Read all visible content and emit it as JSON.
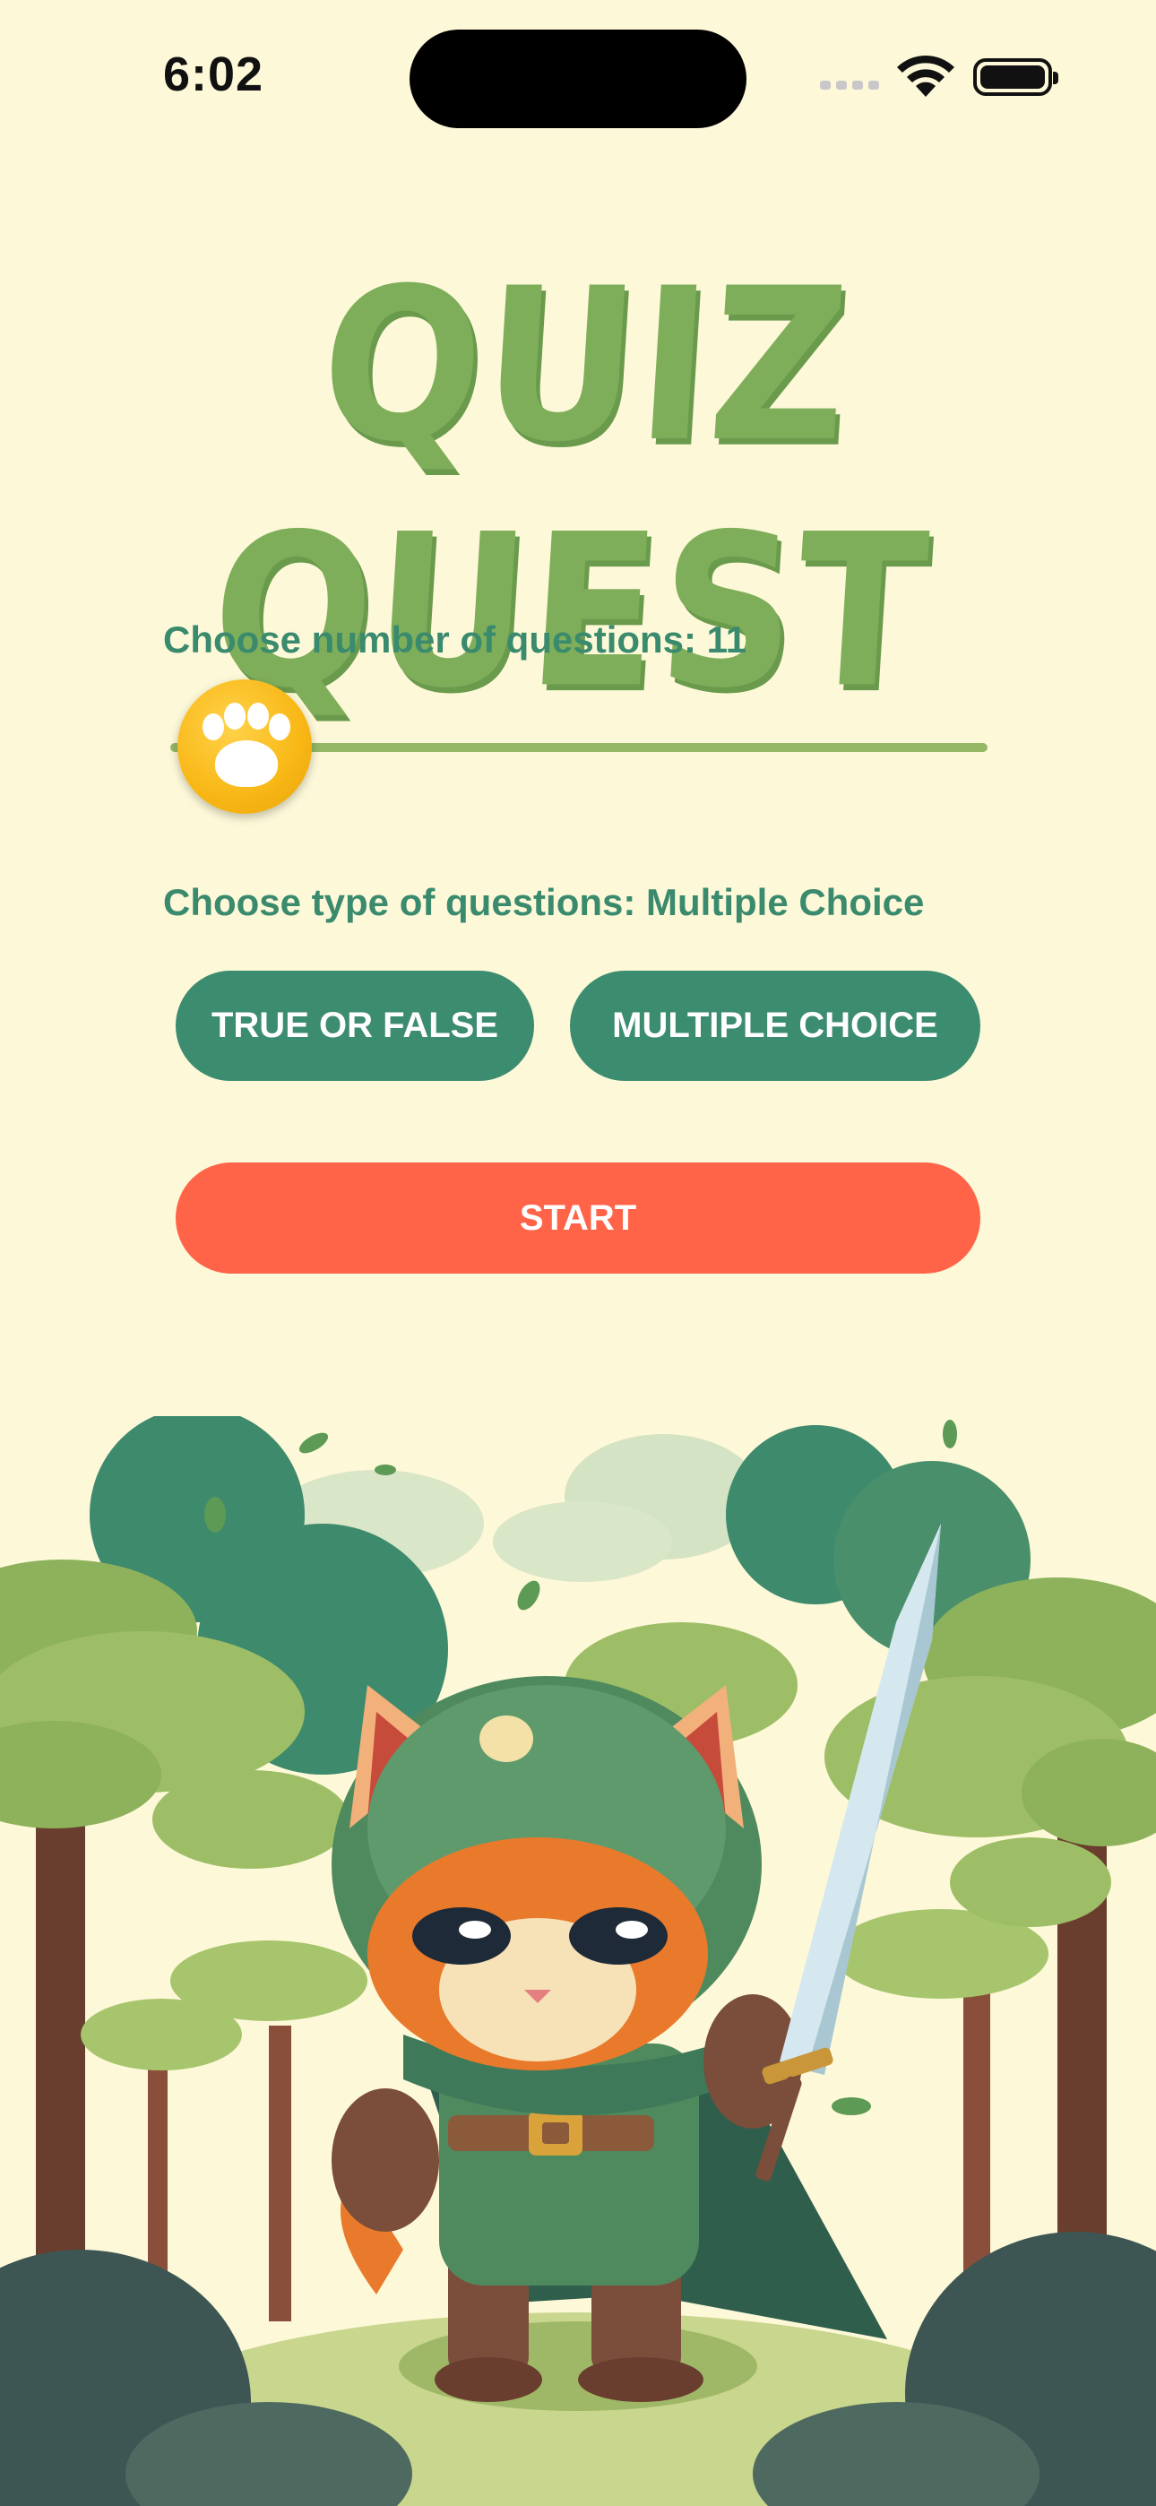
{
  "status_bar": {
    "time": "6:02",
    "icons": [
      "signal-icon",
      "wifi-icon",
      "battery-icon"
    ]
  },
  "app": {
    "title": "QUIZ QUEST"
  },
  "question_count": {
    "label": "Choose number of questions: 11",
    "value": 11,
    "slider_fraction": 0.0
  },
  "question_type": {
    "label": "Choose type of questions: Multiple Choice",
    "selected": "Multiple Choice"
  },
  "buttons": {
    "true_false": "TRUE OR FALSE",
    "multiple_choice": "MULTIPLE CHOICE",
    "start": "START"
  },
  "colors": {
    "background": "#FDF8D8",
    "title_green": "#7FAE5B",
    "label_green": "#3A8A6E",
    "button_green": "#3C8C70",
    "start_orange": "#FF6448",
    "slider_track": "#94B865",
    "thumb_yellow": "#F8B715"
  },
  "illustration": {
    "icon": "cat-knight-forest-illustration"
  }
}
